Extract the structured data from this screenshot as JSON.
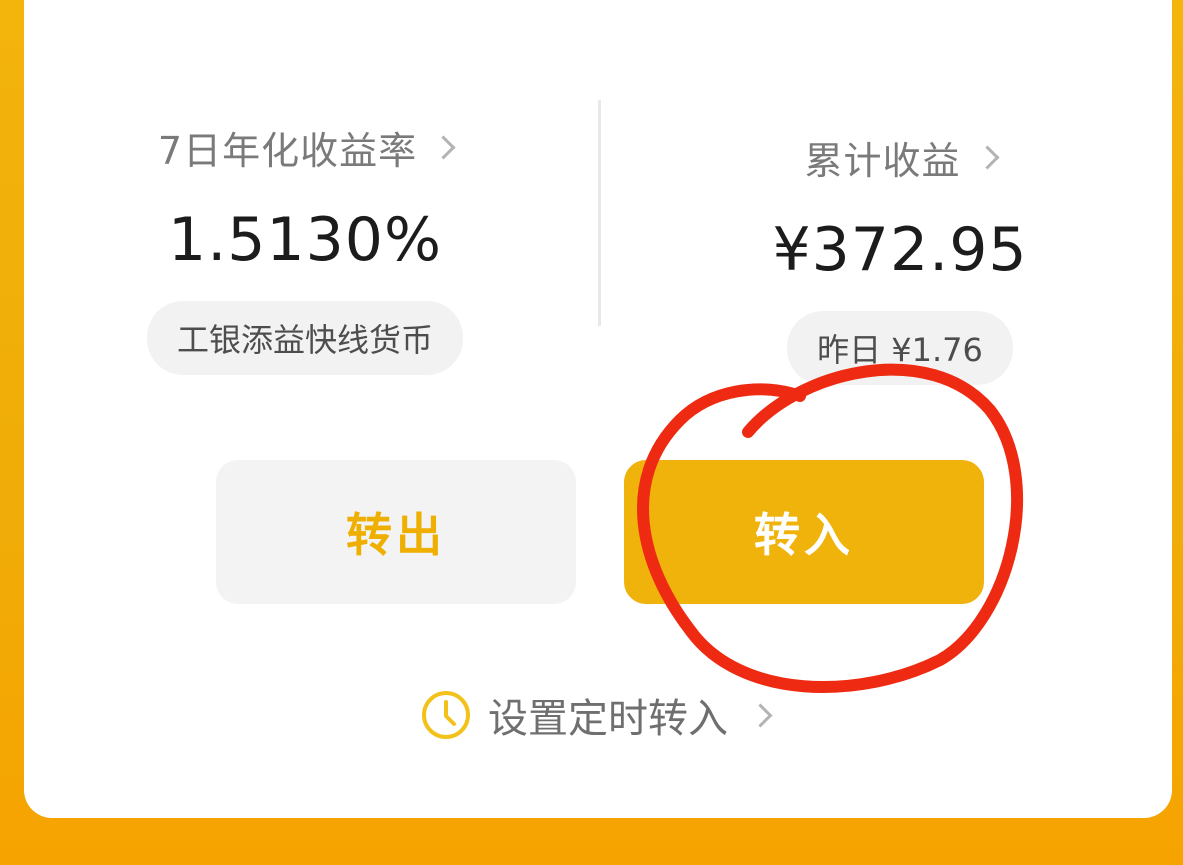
{
  "stats": {
    "left": {
      "label": "7日年化收益率",
      "value": "1.5130%",
      "pill": "工银添益快线货币",
      "icon": "chevron-right-icon"
    },
    "right": {
      "label": "累计收益",
      "value": "¥372.95",
      "pill": "昨日 ¥1.76",
      "icon": "chevron-right-icon"
    }
  },
  "actions": {
    "transfer_out": "转出",
    "transfer_in": "转入"
  },
  "schedule": {
    "label": "设置定时转入",
    "icon": "clock-icon"
  },
  "colors": {
    "accent": "#f0b30c",
    "annotation": "#ee2b12"
  }
}
